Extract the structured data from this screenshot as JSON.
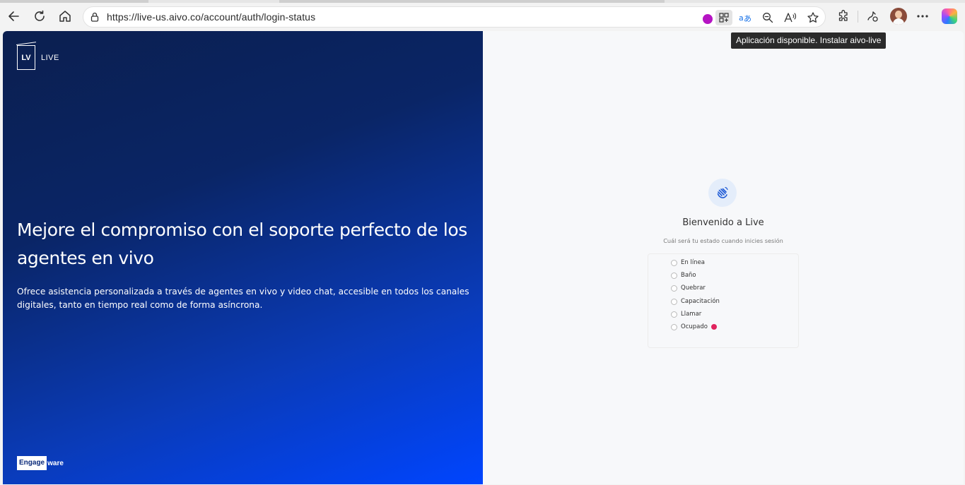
{
  "browser": {
    "url": "https://live-us.aivo.co/account/auth/login-status",
    "tooltip": "Aplicación disponible. Instalar aivo-live",
    "icons": [
      "back-icon",
      "refresh-icon",
      "home-icon",
      "lock-icon",
      "app-available-icon",
      "translate-icon",
      "zoom-out-icon",
      "read-aloud-icon",
      "favorite-icon",
      "extensions-icon",
      "browser-essentials-icon",
      "profile-avatar",
      "more-icon",
      "copilot-icon"
    ]
  },
  "hero": {
    "logo_mark": "LV",
    "logo_text": "LIVE",
    "headline": "Mejore el compromiso con el soporte perfecto de los agentes en vivo",
    "description": "Ofrece asistencia personalizada a través de agentes en vivo y video chat, accesible en todos los canales digitales, tanto en tiempo real como de forma asíncrona.",
    "brand_box": "Engage",
    "brand_rest": "ware",
    "gradient": [
      "#0b1f4f",
      "#0045ff"
    ]
  },
  "login": {
    "title": "Bienvenido a Live",
    "subtitle": "Cuál será tu estado cuando inicies sesión",
    "statuses": [
      {
        "label": "En línea"
      },
      {
        "label": "Baño"
      },
      {
        "label": "Quebrar"
      },
      {
        "label": "Capacitación"
      },
      {
        "label": "Llamar"
      },
      {
        "label": "Ocupado",
        "indicator_color": "#e0245e"
      }
    ]
  }
}
